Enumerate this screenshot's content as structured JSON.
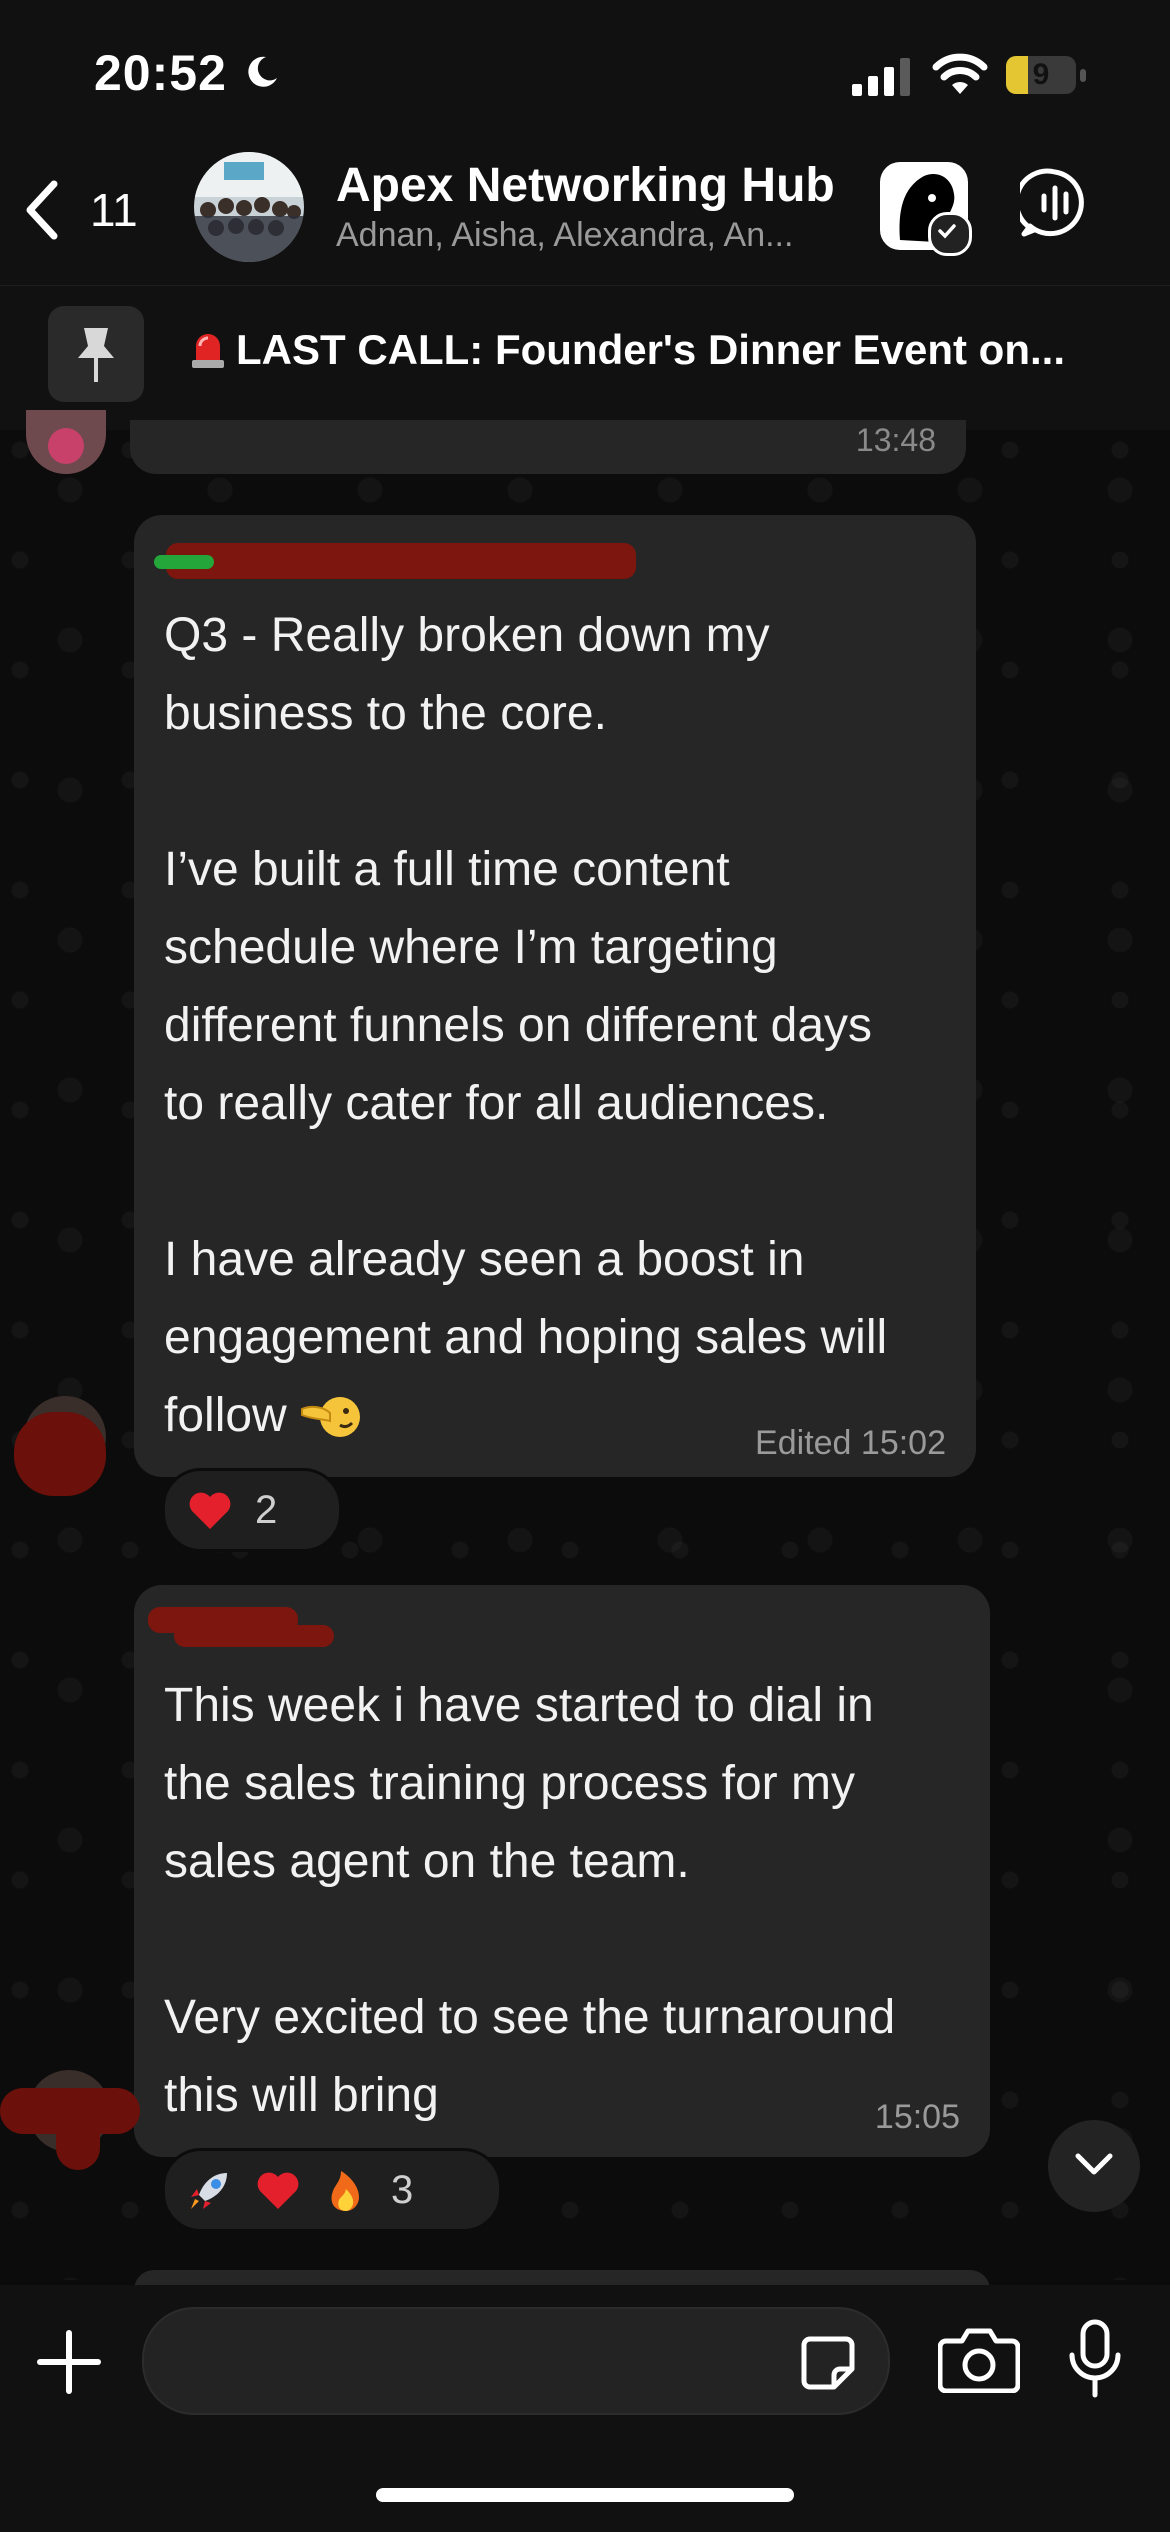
{
  "status_bar": {
    "time": "20:52",
    "battery_level": "9",
    "battery_fraction": 0.09,
    "battery_color": "#e3c632"
  },
  "header": {
    "back_count": "11",
    "group_name": "Apex Networking Hub",
    "members": "Adnan, Aisha, Alexandra, An..."
  },
  "pinned": {
    "text": "LAST CALL: Founder's Dinner Event on...",
    "icon": "pin-icon"
  },
  "chat": {
    "previous_message_time": "13:48",
    "messages": [
      {
        "text": "Q3 - Really broken down my\nbusiness to the core.\n\nI’ve built a full time content\nschedule where I’m targeting\ndifferent funnels on different days\nto really cater for all audiences.\n\nI have already seen a boost in\nengagement and hoping sales will\nfollow ",
        "status": "Edited",
        "time": "15:02",
        "reactions": {
          "emojis": [
            "heart"
          ],
          "count": "2"
        }
      },
      {
        "text": "This week i have started to dial in\nthe sales training process for my\nsales agent on the team.\n\nVery excited to see the turnaround\nthis will bring",
        "time": "15:05",
        "reactions": {
          "emojis": [
            "rocket",
            "heart",
            "fire"
          ],
          "count": "3"
        }
      }
    ]
  },
  "colors": {
    "bubble": "#262626",
    "background": "#0b0b0b",
    "redaction": "#7d160e"
  }
}
